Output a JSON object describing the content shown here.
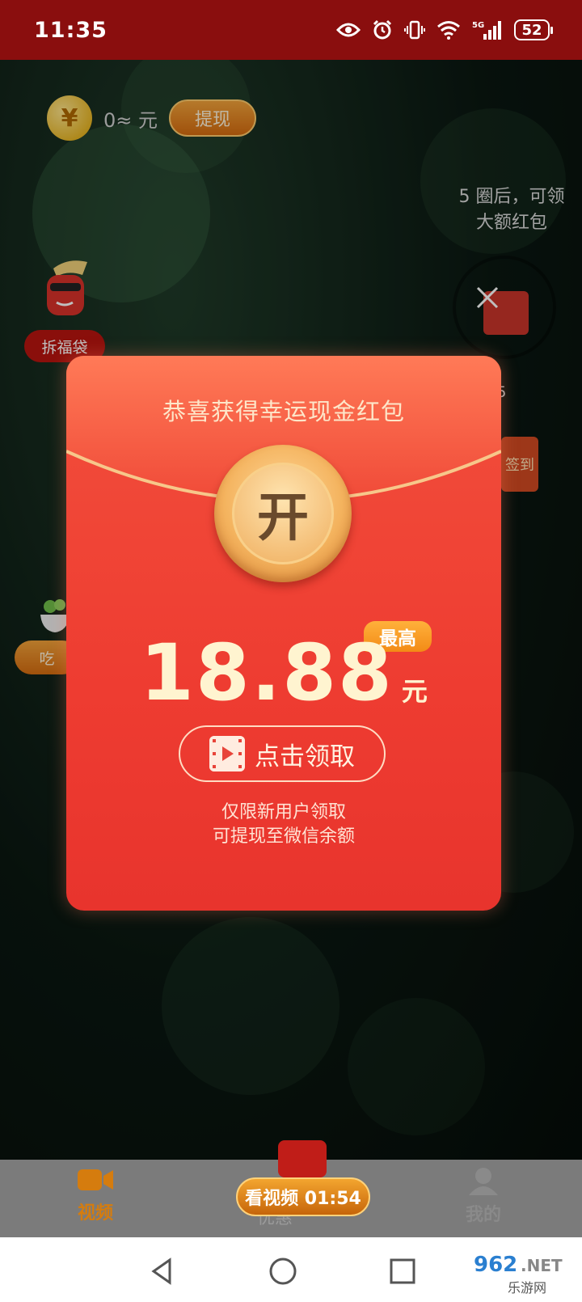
{
  "status_bar": {
    "time": "11:35",
    "battery": "52",
    "network": "5G"
  },
  "header": {
    "coin_symbol": "¥",
    "balance": "0≈ 元",
    "withdraw_label": "提现"
  },
  "side": {
    "fudai_label": "拆福袋",
    "eat_label": "吃",
    "tip_text": "5 圈后，可领大额红包",
    "progress_fraction": "/5",
    "sign_label": "签到"
  },
  "modal": {
    "title": "恭喜获得幸运现金红包",
    "open_label": "开",
    "max_badge": "最高",
    "amount": "18.88",
    "unit": "元",
    "claim_label": "点击领取",
    "note_line1": "仅限新用户领取",
    "note_line2": "可提现至微信余额"
  },
  "tabbar": {
    "video_label": "视频",
    "center_label": "优惠",
    "watch_timer": "看视频 01:54",
    "mine_label": "我的"
  },
  "colors": {
    "packet_red": "#ee3c31",
    "gold": "#f4b35e",
    "status_bar": "#8a0e0e"
  },
  "watermark": {
    "text": "962.NET",
    "sub": "乐游网"
  }
}
